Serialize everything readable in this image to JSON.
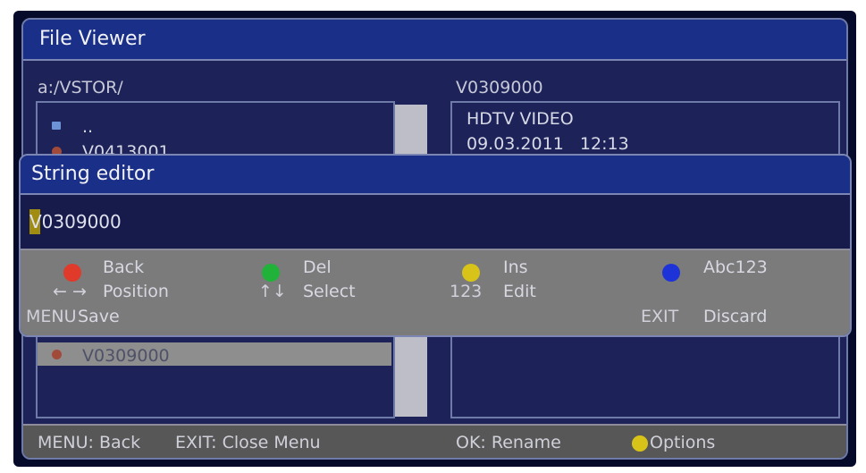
{
  "colors": {
    "red": "#e03a2a",
    "green": "#21b23a",
    "yellow": "#d8c418",
    "blue": "#1d33d8"
  },
  "window": {
    "title": "File Viewer"
  },
  "path": "a:/VSTOR/",
  "selected_file": "V0309000",
  "file_list": {
    "items": [
      {
        "icon": "folder-icon",
        "label": ".."
      },
      {
        "icon": "file-icon",
        "label": "V0413001"
      },
      {
        "icon": "file-icon",
        "label": "V0309000"
      }
    ]
  },
  "info": {
    "line1": "HDTV VIDEO",
    "line2": "09.03.2011   12:13"
  },
  "bottom": {
    "menu_back": "MENU: Back",
    "exit_close": "EXIT: Close Menu",
    "ok_rename": "OK: Rename",
    "options": "Options"
  },
  "editor": {
    "title": "String editor",
    "value": "V0309000",
    "help": {
      "red_label": "Back",
      "green_label": "Del",
      "yellow_label": "Ins",
      "blue_label": "Abc123",
      "arrows_lr": "← →",
      "position": "Position",
      "arrows_ud": "↑↓",
      "select": "Select",
      "num_key": "123",
      "edit": "Edit",
      "menu_key": "MENU",
      "save": "Save",
      "exit_key": "EXIT",
      "discard": "Discard"
    }
  }
}
